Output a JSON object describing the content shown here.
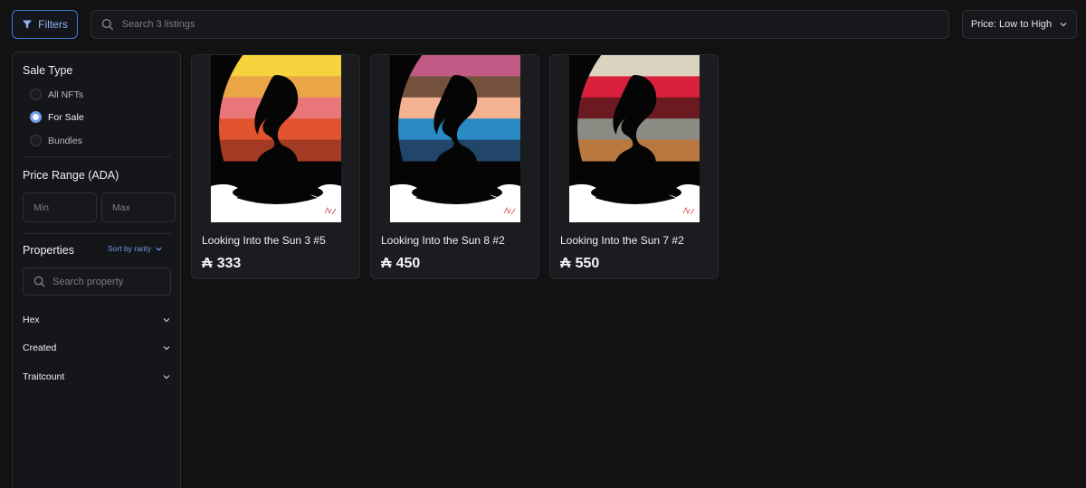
{
  "toolbar": {
    "filters_label": "Filters",
    "search_placeholder": "Search 3 listings",
    "sort_label": "Price: Low to High"
  },
  "sidebar": {
    "sale_type": {
      "heading": "Sale Type",
      "options": [
        {
          "label": "All NFTs",
          "selected": false
        },
        {
          "label": "For Sale",
          "selected": true
        },
        {
          "label": "Bundles",
          "selected": false
        }
      ]
    },
    "price_range": {
      "heading": "Price Range (ADA)",
      "min_placeholder": "Min",
      "max_placeholder": "Max"
    },
    "properties": {
      "heading": "Properties",
      "sort_label": "Sort by rarity",
      "search_placeholder": "Search property",
      "items": [
        {
          "label": "Hex"
        },
        {
          "label": "Created"
        },
        {
          "label": "Traitcount"
        }
      ]
    }
  },
  "currency_symbol": "₳",
  "accent_color": "#6f9eea",
  "listings": [
    {
      "title": "Looking Into the Sun 3 #5",
      "price": "333",
      "stripes": [
        "#f6d23c",
        "#eaa547",
        "#e9777a",
        "#e2542e",
        "#a33a24"
      ]
    },
    {
      "title": "Looking Into the Sun 8 #2",
      "price": "450",
      "stripes": [
        "#c25a86",
        "#74513d",
        "#f3b290",
        "#2a8ac3",
        "#21466a"
      ]
    },
    {
      "title": "Looking Into the Sun 7 #2",
      "price": "550",
      "stripes": [
        "#d9d3c0",
        "#d8213c",
        "#6b1a22",
        "#8b8b83",
        "#b9783f"
      ]
    }
  ]
}
